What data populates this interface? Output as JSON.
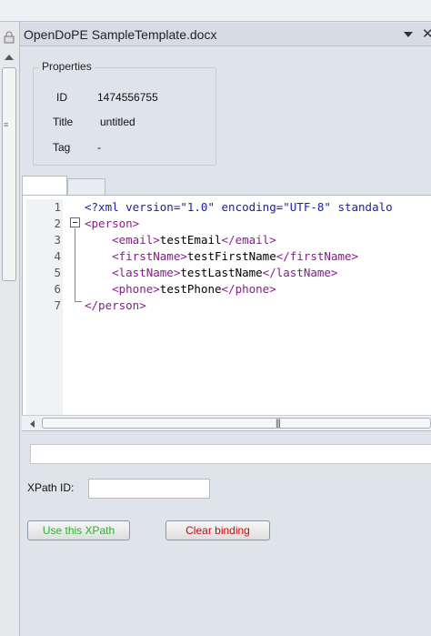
{
  "panel": {
    "title": "OpenDoPE SampleTemplate.docx"
  },
  "properties": {
    "legend": "Properties",
    "id_label": "ID",
    "id_value": "1474556755",
    "title_label": "Title",
    "title_value": "untitled",
    "tag_label": "Tag",
    "tag_value": "-"
  },
  "editor": {
    "line_numbers": [
      "1",
      "2",
      "3",
      "4",
      "5",
      "6",
      "7"
    ],
    "lines": [
      "<?xml version=\"1.0\" encoding=\"UTF-8\" standalo",
      "<person>",
      "    <email>testEmail</email>",
      "    <firstName>testFirstName</firstName>",
      "    <lastName>testLastName</lastName>",
      "    <phone>testPhone</phone>",
      "</person>"
    ]
  },
  "xpath": {
    "label": "XPath ID:",
    "value": "",
    "bar_value": ""
  },
  "buttons": {
    "use_label": "Use this XPath",
    "clear_label": "Clear binding"
  },
  "colors": {
    "tag": "#8a1a8f",
    "declaration": "#1b1bb3",
    "use_button_text": "#2db02d",
    "clear_button_text": "#e00000"
  }
}
